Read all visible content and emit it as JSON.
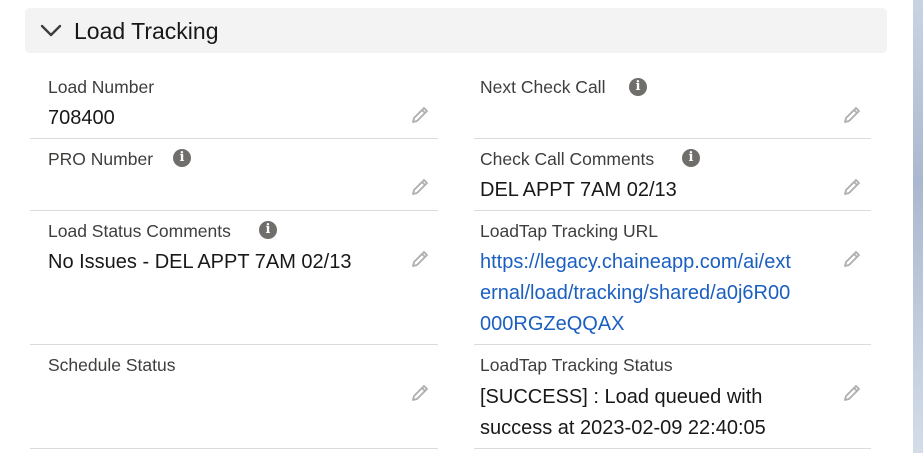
{
  "section": {
    "title": "Load Tracking",
    "expanded": true
  },
  "fields": {
    "load_number": {
      "label": "Load Number",
      "value": "708400"
    },
    "next_check_call": {
      "label": "Next Check Call",
      "value": ""
    },
    "pro_number": {
      "label": "PRO Number",
      "value": ""
    },
    "check_call_comments": {
      "label": "Check Call Comments",
      "value": "DEL APPT 7AM 02/13"
    },
    "load_status_comments": {
      "label": "Load Status Comments",
      "value": "No Issues - DEL APPT 7AM 02/13"
    },
    "loadtap_tracking_url": {
      "label": "LoadTap Tracking URL",
      "line1": "https://legacy.chaineapp.com/ai/ext",
      "line2": "ernal/load/tracking/shared/a0j6R00",
      "line3": "000RGZeQQAX"
    },
    "schedule_status": {
      "label": "Schedule Status",
      "value": ""
    },
    "loadtap_tracking_status": {
      "label": "LoadTap Tracking Status",
      "line1": "[SUCCESS] : Load queued with",
      "line2": "success at 2023-02-09 22:40:05"
    }
  },
  "icons": {
    "info": "info-icon",
    "edit": "pencil-icon",
    "collapse": "chevron-down-icon"
  },
  "colors": {
    "header_bg": "#f3f3f3",
    "link": "#1b5fc1",
    "label": "#3e3e3c",
    "divider": "#dddbda"
  }
}
